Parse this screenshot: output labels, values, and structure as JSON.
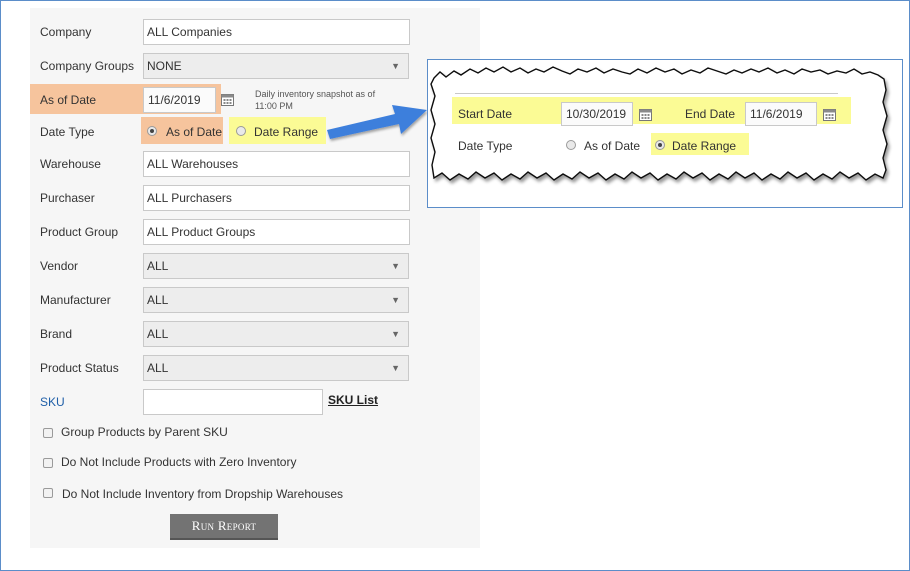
{
  "form": {
    "company": {
      "label": "Company",
      "value": "ALL Companies"
    },
    "company_groups": {
      "label": "Company Groups",
      "value": "NONE"
    },
    "as_of_date": {
      "label": "As of Date",
      "value": "11/6/2019",
      "note": "Daily inventory snapshot as of 11:00 PM"
    },
    "date_type": {
      "label": "Date Type",
      "option_as_of": "As of Date",
      "option_range": "Date Range",
      "selected": "As of Date"
    },
    "warehouse": {
      "label": "Warehouse",
      "value": "ALL Warehouses"
    },
    "purchaser": {
      "label": "Purchaser",
      "value": "ALL Purchasers"
    },
    "product_group": {
      "label": "Product Group",
      "value": "ALL Product Groups"
    },
    "vendor": {
      "label": "Vendor",
      "value": "ALL"
    },
    "manufacturer": {
      "label": "Manufacturer",
      "value": "ALL"
    },
    "brand": {
      "label": "Brand",
      "value": "ALL"
    },
    "product_status": {
      "label": "Product Status",
      "value": "ALL"
    },
    "sku": {
      "label": "SKU",
      "value": "",
      "list_link": "SKU List"
    },
    "checkboxes": [
      {
        "label": "Group Products by Parent SKU",
        "checked": false
      },
      {
        "label": "Do Not Include Products with Zero Inventory",
        "checked": false
      },
      {
        "label": "Do Not Include Inventory from Dropship Warehouses",
        "checked": false
      }
    ],
    "run_button": "Run Report"
  },
  "inset": {
    "start_date": {
      "label": "Start Date",
      "value": "10/30/2019"
    },
    "end_date": {
      "label": "End Date",
      "value": "11/6/2019"
    },
    "date_type": {
      "label": "Date Type",
      "option_as_of": "As of Date",
      "option_range": "Date Range",
      "selected": "Date Range"
    }
  },
  "colors": {
    "highlight_orange": "#f6c49d",
    "highlight_yellow": "#fbfb95",
    "arrow": "#3d7fdc",
    "link": "#1f5fa8"
  },
  "icons": {
    "calendar": "calendar-icon",
    "dropdown": "chevron-down-icon",
    "arrow": "arrow-right-icon"
  }
}
